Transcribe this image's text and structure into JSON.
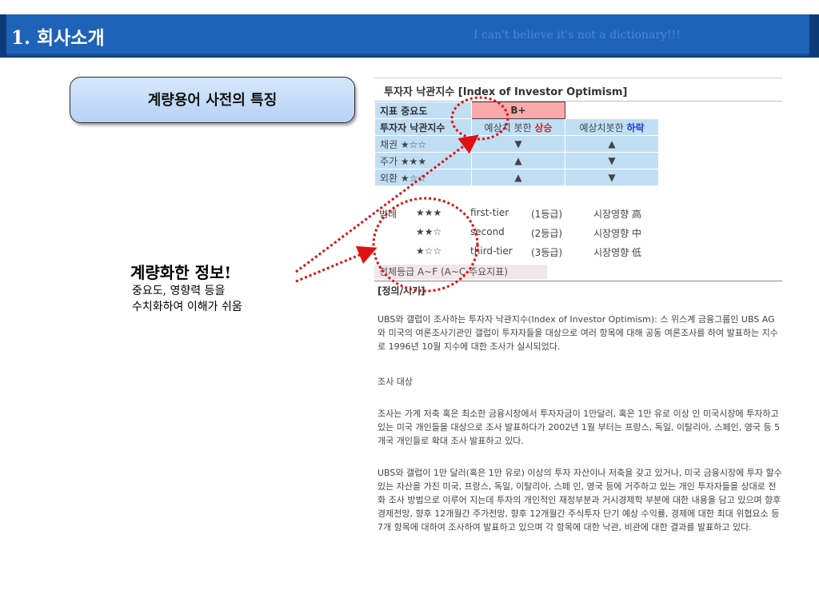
{
  "header": {
    "title": "1. 회사소개",
    "tagline": "I can't believe it's not a dictionary!!!"
  },
  "feature_box": {
    "label": "계량용어 사전의 특징"
  },
  "callout": {
    "title": "계량화한 정보!",
    "desc_line1": "중요도, 영향력 등을",
    "desc_line2": "수치화하여 이해가 쉬움"
  },
  "entry": {
    "heading": "투자자 낙관지수 [Index of Investor Optimism]",
    "importance_label": "지표 중요도",
    "grade": "B+",
    "table_head": {
      "col1": "투자자 낙관지수",
      "col2_prefix": "예상치 봇한",
      "col2_emph": "상승",
      "col3_prefix": "예상치봇한",
      "col3_emph": "하락"
    },
    "rows": [
      {
        "label": "채권 ★☆☆",
        "up": "▼",
        "down": "▲"
      },
      {
        "label": "주가 ★★★",
        "up": "▲",
        "down": "▼"
      },
      {
        "label": "외환 ★☆☆",
        "up": "▲",
        "down": "▼"
      }
    ],
    "legend_label": "범례",
    "legend": [
      {
        "stars": "★★★",
        "tier": "first-tier",
        "grade": "(1등급)",
        "impact": "시장영향 高"
      },
      {
        "stars": "★★☆",
        "tier": "second",
        "grade": "(2등급)",
        "impact": "시장영향 中"
      },
      {
        "stars": "★☆☆",
        "tier": "third-tier",
        "grade": "(3등급)",
        "impact": "시장영향 低"
      }
    ],
    "overall": "전체등급 A~F (A~C 주요지표)",
    "definition_label": "[정의/시기]",
    "para1": "UBS와 갤럽이 조사하는 투자자 낙관지수(Index of Investor Optimism): 스 위스계 금융그룹인 UBS AG와 미국의 여론조사기관인 갤럽이 투자자들을 대상으로 여러 항목에 대해 공동 여론조사를 하여 발표하는 지수로 1996년 10월 지수에 대한 조사가 실시되었다.",
    "para2": "조사 대상",
    "para3": "조사는 가계 저축 혹은 최소한 금융시장에서 투자자금이 1만달러, 혹은 1만 유로 이상 인 미국시장에 투자하고 있는 미국 개인들을 대상으로 조사 발표하다가 2002년 1월 부터는 프랑스, 독일, 이탈리아, 스페인, 영국 등 5개국 개인들로 확대 조사 발표하고 있다.",
    "para4": "UBS와 갤럽이 1만 달러(혹은 1만 유로) 이상의 투자 자산이나 저축을 갖고 있거나, 미국 금융시장에 투자 할수 있는 자산을 가진 미국, 프랑스, 독일, 이탈리아, 스페 인, 영국 등에 거주하고 있는 개인 투자자들을 상대로 전화 조사 방법으로 이루어 지는데 투자의 개인적인 재정부분과 거시경제학 부분에 대한 내용을 담고 있으며 향후 경제전망, 향후 12개월간 주가전망, 향후 12개월간 주식투자 단기 예상 수익률, 경제에 대한 최대 위협요소 등 7개 항목에 대하여 조사하여 발표하고 있으며 각 항목에 대한 낙관, 비관에 대한 결과를 발표하고 있다."
  },
  "colors": {
    "header_bg": "#1f63b8",
    "tagline": "#4b86d6",
    "arrow": "#e01010",
    "cell_bg": "#c0dff5",
    "grade_bg": "#f9a9aa"
  }
}
